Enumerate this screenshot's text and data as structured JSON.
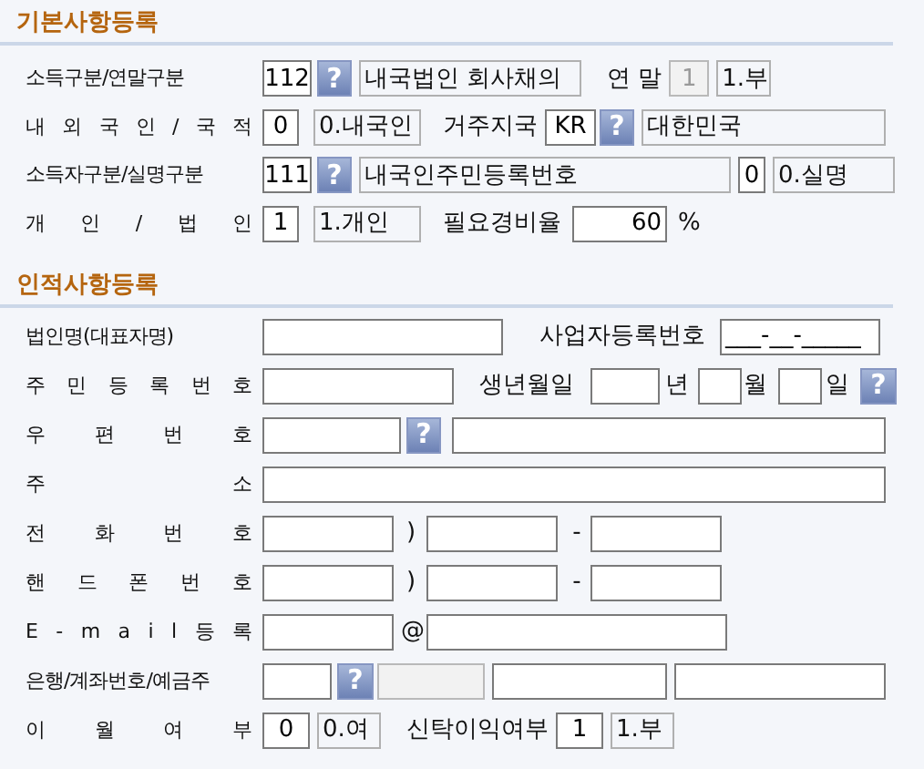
{
  "sections": [
    {
      "title": "기본사항등록",
      "rows": [
        {
          "label": "소득구분/연말구분",
          "fields": [
            {
              "kind": "code",
              "value": "112",
              "disabled": false
            },
            {
              "kind": "help",
              "glyph": "?"
            },
            {
              "kind": "text",
              "value": "내국법인 회사채의"
            },
            {
              "kind": "label",
              "value": "연 말"
            },
            {
              "kind": "code",
              "value": "1",
              "disabled": true
            },
            {
              "kind": "text",
              "value": "1.부"
            }
          ]
        },
        {
          "label": "내 외 국 인 / 국 적",
          "fields": [
            {
              "kind": "code",
              "value": "0",
              "disabled": false
            },
            {
              "kind": "text",
              "value": "0.내국인"
            },
            {
              "kind": "label",
              "value": "거주지국"
            },
            {
              "kind": "code",
              "value": "KR",
              "disabled": false
            },
            {
              "kind": "help",
              "glyph": "?"
            },
            {
              "kind": "text",
              "value": "대한민국"
            }
          ]
        },
        {
          "label": "소득자구분/실명구분",
          "fields": [
            {
              "kind": "code",
              "value": "111",
              "disabled": false
            },
            {
              "kind": "help",
              "glyph": "?"
            },
            {
              "kind": "text",
              "value": "내국인주민등록번호"
            },
            {
              "kind": "code",
              "value": "0",
              "disabled": false
            },
            {
              "kind": "text",
              "value": "0.실명"
            }
          ]
        },
        {
          "label": "개 인 / 법 인",
          "fields": [
            {
              "kind": "code",
              "value": "1",
              "disabled": false
            },
            {
              "kind": "text",
              "value": "1.개인"
            },
            {
              "kind": "label",
              "value": "필요경비율"
            },
            {
              "kind": "number",
              "value": "60",
              "disabled": false
            },
            {
              "kind": "label",
              "value": "%"
            }
          ]
        }
      ]
    },
    {
      "title": "인적사항등록",
      "rows": [
        {
          "label": "법인명(대표자명)",
          "fields": [
            {
              "kind": "input",
              "disabled": false
            },
            {
              "kind": "label",
              "value": "사업자등록번호"
            },
            {
              "kind": "input",
              "value": "___-__-_____",
              "disabled": false
            }
          ]
        },
        {
          "label": "주 민 등 록 번 호",
          "fields": [
            {
              "kind": "input",
              "disabled": false
            },
            {
              "kind": "label",
              "value": "생년월일"
            },
            {
              "kind": "input",
              "disabled": false
            },
            {
              "kind": "label",
              "value": "년"
            },
            {
              "kind": "input",
              "disabled": false
            },
            {
              "kind": "label",
              "value": "월"
            },
            {
              "kind": "input",
              "disabled": false
            },
            {
              "kind": "label",
              "value": "일"
            },
            {
              "kind": "help",
              "glyph": "?"
            }
          ]
        },
        {
          "label": "우 편 번 호",
          "fields": [
            {
              "kind": "input",
              "disabled": false
            },
            {
              "kind": "help",
              "glyph": "?"
            },
            {
              "kind": "input",
              "disabled": false
            }
          ]
        },
        {
          "label": "주 소",
          "fields": [
            {
              "kind": "input",
              "disabled": false
            }
          ]
        },
        {
          "label": "전 화 번 호",
          "fields": [
            {
              "kind": "input",
              "disabled": false
            },
            {
              "kind": "label",
              "value": ")"
            },
            {
              "kind": "input",
              "disabled": false
            },
            {
              "kind": "label",
              "value": "-"
            },
            {
              "kind": "input",
              "disabled": false
            }
          ]
        },
        {
          "label": "핸 드 폰 번 호",
          "fields": [
            {
              "kind": "input",
              "disabled": false
            },
            {
              "kind": "label",
              "value": ")"
            },
            {
              "kind": "input",
              "disabled": false
            },
            {
              "kind": "label",
              "value": "-"
            },
            {
              "kind": "input",
              "disabled": false
            }
          ]
        },
        {
          "label": "E - m a i l 등 록",
          "fields": [
            {
              "kind": "input",
              "disabled": false
            },
            {
              "kind": "label",
              "value": "@"
            },
            {
              "kind": "input",
              "disabled": false
            }
          ]
        },
        {
          "label": "은행/계좌번호/예금주",
          "fields": [
            {
              "kind": "input",
              "disabled": false
            },
            {
              "kind": "help",
              "glyph": "?"
            },
            {
              "kind": "input",
              "disabled": true
            },
            {
              "kind": "input",
              "disabled": false
            },
            {
              "kind": "input",
              "disabled": false
            }
          ]
        },
        {
          "label": "이 월 여 부",
          "fields": [
            {
              "kind": "code",
              "value": "0",
              "disabled": false
            },
            {
              "kind": "text",
              "value": "0.여"
            },
            {
              "kind": "label",
              "value": "신탁이익여부"
            },
            {
              "kind": "code",
              "value": "1",
              "disabled": false
            },
            {
              "kind": "text",
              "value": "1.부"
            }
          ]
        }
      ]
    }
  ]
}
